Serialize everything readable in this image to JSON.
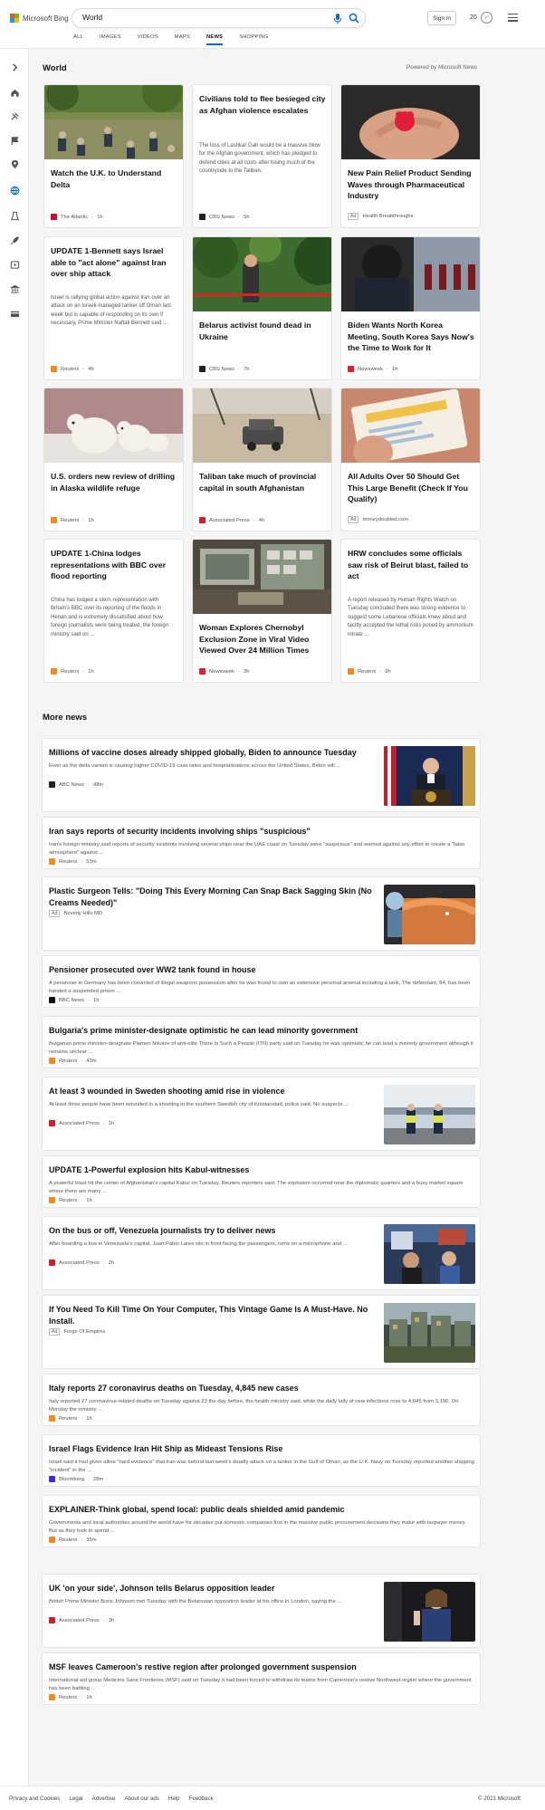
{
  "brand": "Microsoft Bing",
  "search": {
    "value": "World"
  },
  "header": {
    "signin": "Sign in",
    "points": "20"
  },
  "tabs": [
    "ALL",
    "IMAGES",
    "VIDEOS",
    "MAPS",
    "NEWS",
    "SHOPPING"
  ],
  "active_tab": "NEWS",
  "rail_icons": [
    "chevron-right-icon",
    "home-icon",
    "tools-icon",
    "flag-icon",
    "location-icon",
    "globe-icon",
    "science-icon",
    "rocket-icon",
    "play-icon",
    "money-icon",
    "card-icon"
  ],
  "section": {
    "title": "World",
    "powered": "Powered by Microsoft News"
  },
  "cards": [
    {
      "title": "Watch the U.K. to Understand Delta",
      "source": "The Atlantic",
      "time": "1h",
      "favicon_color": "#c8102e"
    },
    {
      "title": "Civilians told to flee besieged city as Afghan violence escalates",
      "snippet": "The loss of Lashkar Gah would be a massive blow for the Afghan government, which has pledged to defend cities at all costs after losing much of the countryside to the Taliban.",
      "source": "CBS News",
      "time": "5h",
      "favicon_color": "#222222"
    },
    {
      "title": "New Pain Relief Product Sending Waves through Pharmaceutical Industry",
      "ad": "Ad",
      "source": "Health Breakthroughs",
      "time": "",
      "favicon_color": ""
    },
    {
      "title": "UPDATE 1-Bennett says Israel able to \"act alone\" against Iran over ship attack",
      "snippet": "Israel is rallying global action against Iran over an attack on an Israeli-managed tanker off Oman last week but is capable of responding on its own if necessary, Prime Minister Naftali Bennett said ...",
      "source": "Reuters",
      "time": "4h",
      "favicon_color": "#f28a1c"
    },
    {
      "title": "Belarus activist found dead in Ukraine",
      "source": "CBS News",
      "time": "7h",
      "favicon_color": "#222222"
    },
    {
      "title": "Biden Wants North Korea Meeting, South Korea Says Now's the Time to Work for It",
      "source": "Newsweek",
      "time": "1h",
      "favicon_color": "#e4202e"
    },
    {
      "title": "U.S. orders new review of drilling in Alaska wildlife refuge",
      "source": "Reuters",
      "time": "1h",
      "favicon_color": "#f28a1c"
    },
    {
      "title": "Taliban take much of provincial capital in south Afghanistan",
      "source": "Associated Press",
      "time": "4h",
      "favicon_color": "#d11f2a"
    },
    {
      "title": "All Adults Over 50 Should Get This Large Benefit (Check If You Qualify)",
      "ad": "Ad",
      "source": "moneydoubled.com",
      "time": "",
      "favicon_color": ""
    },
    {
      "title": "UPDATE 1-China lodges representations with BBC over flood reporting",
      "snippet": "China has lodged a stern representation with Britain's BBC over its reporting of the floods in Henan and is extremely dissatisfied about how foreign journalists were being treated, the foreign ministry said on ...",
      "source": "Reuters",
      "time": "1h",
      "favicon_color": "#f28a1c"
    },
    {
      "title": "Woman Explores Chernobyl Exclusion Zone in Viral Video Viewed Over 24 Million Times",
      "source": "Newsweek",
      "time": "3h",
      "favicon_color": "#e4202e"
    },
    {
      "title": "HRW concludes some officials saw risk of Beirut blast, failed to act",
      "snippet": "A report released by Human Rights Watch on Tuesday concluded there was strong evidence to suggest some Lebanese officials knew about and tacitly accepted the lethal risks posed by ammonium nitrate ...",
      "source": "Reuters",
      "time": "9h",
      "favicon_color": "#f28a1c"
    }
  ],
  "more_news": {
    "title": "More news",
    "items": [
      {
        "title": "Millions of vaccine doses already shipped globally, Biden to announce Tuesday",
        "snippet": "Even as the delta variant is causing higher COVID-19 case rates and hospitalizations across the United States, Biden will ...",
        "source": "ABC News",
        "time": "48m",
        "favicon_color": "#222222",
        "has_image": true
      },
      {
        "title": "Iran says reports of security incidents involving ships \"suspicious\"",
        "snippet": "Iran's foreign ministry said reports of security incidents involving several ships near the UAE coast on Tuesday were \"suspicious\" and warned against any effort to create a \"false atmosphere\" against ...",
        "source": "Reuters",
        "time": "53m",
        "favicon_color": "#f28a1c",
        "has_image": false
      },
      {
        "title": "Plastic Surgeon Tells: \"Doing This Every Morning Can Snap Back Sagging Skin (No Creams Needed)\"",
        "ad": "Ad",
        "source": "Beverly Hills MD",
        "time": "",
        "favicon_color": "",
        "has_image": true
      },
      {
        "title": "Pensioner prosecuted over WW2 tank found in house",
        "snippet": "A pensioner in Germany has been convicted of illegal weapons possession after he was found to own an extensive personal arsenal including a tank. The defendant, 84, has been handed a suspended prison ...",
        "source": "BBC News",
        "time": "1h",
        "favicon_color": "#111111",
        "has_image": false
      },
      {
        "title": "Bulgaria's prime minister-designate optimistic he can lead minority government",
        "snippet": "Bulgarian prime minister-designate Plamen Nikolov of anti-elite There Is Such a People (ITN) party said on Tuesday he was optimistic he can lead a minority government although it remains unclear ...",
        "source": "Reuters",
        "time": "43m",
        "favicon_color": "#f28a1c",
        "has_image": false
      },
      {
        "title": "At least 3 wounded in Sweden shooting amid rise in violence",
        "snippet": "At least three people have been wounded in a shooting in the southern Swedish city of Kristianstad, police said. No suspects ...",
        "source": "Associated Press",
        "time": "1h",
        "favicon_color": "#d11f2a",
        "has_image": true
      },
      {
        "title": "UPDATE 1-Powerful explosion hits Kabul-witnesses",
        "snippet": "A powerful blast hit the center of Afghanistan's capital Kabul on Tuesday, Reuters reporters said. The explosion occurred near the diplomatic quarters and a busy market square where there are many ...",
        "source": "Reuters",
        "time": "1h",
        "favicon_color": "#f28a1c",
        "has_image": false
      },
      {
        "title": "On the bus or off, Venezuela journalists try to deliver news",
        "snippet": "After boarding a bus in Venezuela's capital, Juan Pablo Lares sits in front facing the passengers, turns on a microphone and ...",
        "source": "Associated Press",
        "time": "2h",
        "favicon_color": "#d11f2a",
        "has_image": true
      },
      {
        "title": "If You Need To Kill Time On Your Computer, This Vintage Game Is A Must-Have. No Install.",
        "ad": "Ad",
        "source": "Forge Of Empires",
        "time": "",
        "favicon_color": "",
        "has_image": true
      },
      {
        "title": "Italy reports 27 coronavirus deaths on Tuesday, 4,845 new cases",
        "snippet": "Italy reported 27 coronavirus-related deaths on Tuesday against 23 the day before, the health ministry said, while the daily tally of new infections rose to 4,845 from 3,190. On Monday the ministry ...",
        "source": "Reuters",
        "time": "1h",
        "favicon_color": "#f28a1c",
        "has_image": false
      },
      {
        "title": "Israel Flags Evidence Iran Hit Ship as Mideast Tensions Rise",
        "snippet": "Israel said it had given allies \"hard evidence\" that Iran was behind last week's deadly attack on a tanker in the Gulf of Oman, as the U.K. Navy on Tuesday reported another shipping \"incident\" in the ...",
        "source": "Bloomberg",
        "time": "28m",
        "favicon_color": "#3b2bd8",
        "has_image": false
      },
      {
        "title": "EXPLAINER-Think global, spend local: public deals shielded amid pandemic",
        "snippet": "Governments and local authorities around the world have for decades put domestic companies first in the massive public procurement decisions they make with taxpayer money. But as they look to spend ...",
        "source": "Reuters",
        "time": "35m",
        "favicon_color": "#f28a1c",
        "has_image": false
      },
      {
        "title": "UK 'on your side', Johnson tells Belarus opposition leader",
        "snippet": "British Prime Minister Boris Johnson met Tuesday with the Belarusian opposition leader at his office in London, saying the ...",
        "source": "Associated Press",
        "time": "3h",
        "favicon_color": "#d11f2a",
        "has_image": true
      },
      {
        "title": "MSF leaves Cameroon's restive region after prolonged government suspension",
        "snippet": "International aid group Medicins Sans Frontieres (MSF) said on Tuesday it had been forced to withdraw its teams from Cameroon's restive Northwest region where the government has been battling ...",
        "source": "Reuters",
        "time": "1h",
        "favicon_color": "#f28a1c",
        "has_image": false
      }
    ]
  },
  "footer": {
    "links": [
      "Privacy and Cookies",
      "Legal",
      "Advertise",
      "About our ads",
      "Help",
      "Feedback"
    ],
    "copyright": "© 2021 Microsoft"
  }
}
